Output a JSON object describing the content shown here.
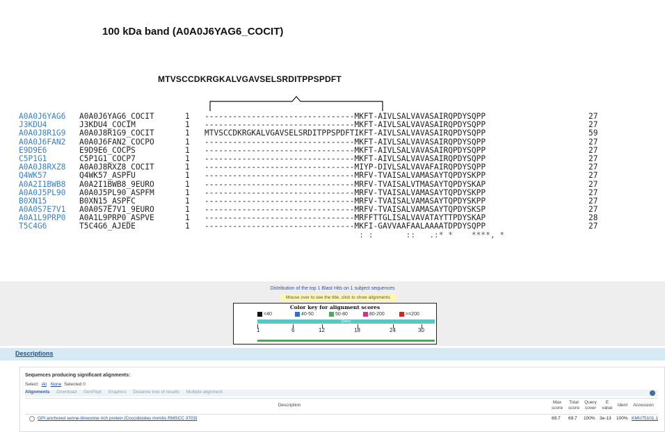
{
  "title": "100 kDa  band (A0A0J6YAG6_COCIT)",
  "query_sequence": "MTVSCCDKRGKALVGAVSELSRDITPPSPDFT",
  "alignment": {
    "rows": [
      {
        "acc": "A0A0J6YAG6",
        "name": "A0A0J6YAG6_COCIT",
        "start": "1",
        "seq": "--------------------------------MKFT-AIVLSALVAVASAIRQPDYSQPP",
        "end": "27"
      },
      {
        "acc": "J3KDU4",
        "name": "J3KDU4_COCIM",
        "start": "1",
        "seq": "--------------------------------MKFT-AIVLSALVAVASAIRQPDYSQPP",
        "end": "27"
      },
      {
        "acc": "A0A0J8R1G9",
        "name": "A0A0J8R1G9_COCIT",
        "start": "1",
        "seq": "MTVSCCDKRGKALVGAVSELSRDITPPSPDFTIKFT-AIVLSALVAVASAIRQPDYSQPP",
        "end": "59"
      },
      {
        "acc": "A0A0J6FAN2",
        "name": "A0A0J6FAN2_COCPO",
        "start": "1",
        "seq": "--------------------------------MKFT-AIVLSALVAVASAIRQPDYSQPP",
        "end": "27"
      },
      {
        "acc": "E9D9E6",
        "name": "E9D9E6_COCPS",
        "start": "1",
        "seq": "--------------------------------MKFT-AIVLSALVAVASAIRQPDYSQPP",
        "end": "27"
      },
      {
        "acc": "C5P1G1",
        "name": "C5P1G1_COCP7",
        "start": "1",
        "seq": "--------------------------------MKFT-AIVLSALVAVASAIRQPDYSQPP",
        "end": "27"
      },
      {
        "acc": "A0A0J8RXZ8",
        "name": "A0A0J8RXZ8_COCIT",
        "start": "1",
        "seq": "--------------------------------MIYP-DIVLSALVAVAFAIRQPDYSQPP",
        "end": "27"
      },
      {
        "acc": "Q4WK57",
        "name": "Q4WK57_ASPFU",
        "start": "1",
        "seq": "--------------------------------MRFV-TVAISALVAMASAYTQPDYSKPP",
        "end": "27"
      },
      {
        "acc": "A0A2I1BWB8",
        "name": "A0A2I1BWB8_9EURO",
        "start": "1",
        "seq": "--------------------------------MRFV-TVAISALVTMASAYTQPDYSKAP",
        "end": "27"
      },
      {
        "acc": "A0A0J5PL90",
        "name": "A0A0J5PL90_ASPFM",
        "start": "1",
        "seq": "--------------------------------MRFV-TVAISALVAMASAYTQPDYSKPP",
        "end": "27"
      },
      {
        "acc": "B0XN15",
        "name": "B0XN15_ASPFC",
        "start": "1",
        "seq": "--------------------------------MRFV-TVAISALVAMASAYTQPDYSKPP",
        "end": "27"
      },
      {
        "acc": "A0A0S7E7V1",
        "name": "A0A0S7E7V1_9EURO",
        "start": "1",
        "seq": "--------------------------------MRFV-TVAISALVAMASAYTQPDYSKSP",
        "end": "27"
      },
      {
        "acc": "A0A1L9PRP0",
        "name": "A0A1L9PRP0_ASPVE",
        "start": "1",
        "seq": "--------------------------------MRFFTTGLISALVAVATAYTTPDYSKAP",
        "end": "28"
      },
      {
        "acc": "T5C4G6",
        "name": "T5C4G6_AJEDE",
        "start": "1",
        "seq": "--------------------------------MKFI-GAVVAAFAALAAAATDPDYSQPP",
        "end": "27"
      }
    ],
    "consensus": "                                 : :       ::   .:* *    ****, *"
  },
  "blast": {
    "distribution_header": "Distribution of the top 1 Blast Hits on 1 subject sequences",
    "mouse_hint": "Mouse over to see the title, click to show alignments",
    "color_key_title": "Color key for alignment scores",
    "color_key": [
      {
        "label": "<40",
        "color": "#111111"
      },
      {
        "label": "40-50",
        "color": "#2f6fd0"
      },
      {
        "label": "50-80",
        "color": "#3ab54a"
      },
      {
        "label": "80-200",
        "color": "#d4308c"
      },
      {
        "label": ">=200",
        "color": "#e02020"
      }
    ],
    "query_label": "Query",
    "ticks": [
      "1",
      "6",
      "12",
      "18",
      "24",
      "30"
    ]
  },
  "descriptions": {
    "tab_label": "Descriptions",
    "heading": "Sequences producing significant alignments:",
    "select_label": "Select:",
    "select_all": "All",
    "select_none": "None",
    "selected_count": "Selected 0",
    "toolbar": [
      "Alignments",
      "Download",
      "GenPept",
      "Graphics",
      "Distance tree of results",
      "Multiple alignment"
    ],
    "columns": {
      "description": "Description",
      "max_score": "Max score",
      "total_score": "Total score",
      "query_cover": "Query cover",
      "e_value": "E value",
      "ident": "Ident",
      "accession": "Accession"
    },
    "row": {
      "description": "GPI anchored serine-threonine rich protein [Coccidioides immitis RMSCC 3703]",
      "max_score": "69.7",
      "total_score": "69.7",
      "query_cover": "100%",
      "e_value": "3e-13",
      "ident": "100%",
      "accession": "KMU75101.1"
    }
  }
}
